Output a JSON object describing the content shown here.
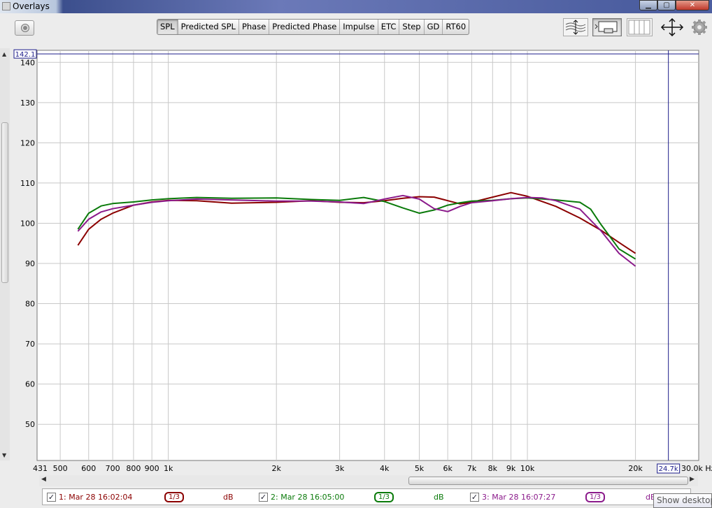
{
  "window": {
    "title": "Overlays"
  },
  "tabs": [
    "SPL",
    "Predicted SPL",
    "Phase",
    "Predicted Phase",
    "Impulse",
    "ETC",
    "Step",
    "GD",
    "RT60"
  ],
  "active_tab": "SPL",
  "cursor": {
    "y_readout": "142.1",
    "x_readout": "24.7k"
  },
  "tooltip": "Show desktop",
  "legend": [
    {
      "check": "✓",
      "name": "1: Mar 28 16:02:04",
      "smoothing": "1/3",
      "unit": "dB",
      "color": "#8b0000"
    },
    {
      "check": "✓",
      "name": "2: Mar 28 16:05:00",
      "smoothing": "1/3",
      "unit": "dB",
      "color": "#0a7a0a"
    },
    {
      "check": "✓",
      "name": "3: Mar 28 16:07:27",
      "smoothing": "1/3",
      "unit": "dB",
      "color": "#8b1a8b"
    }
  ],
  "chart_data": {
    "type": "line",
    "x_scale": "log",
    "xlim": [
      431,
      30000
    ],
    "ylim": [
      41,
      143
    ],
    "ylabel": "dB",
    "xunit": "Hz",
    "grid": true,
    "y_ticks": [
      140,
      130,
      120,
      110,
      100,
      90,
      80,
      70,
      60,
      50
    ],
    "x_tick_values": [
      431,
      500,
      600,
      700,
      800,
      900,
      1000,
      2000,
      3000,
      4000,
      5000,
      6000,
      7000,
      8000,
      9000,
      10000,
      20000,
      30000
    ],
    "x_tick_labels": [
      "431",
      "500",
      "600",
      "700",
      "800",
      "900",
      "1k",
      "2k",
      "3k",
      "4k",
      "5k",
      "6k",
      "7k",
      "8k",
      "9k",
      "10k",
      "20k",
      "30.0k Hz"
    ],
    "cursor": {
      "x": 24700,
      "y": 142.1
    },
    "series": [
      {
        "color": "#8b0000",
        "x": [
          560,
          600,
          650,
          700,
          800,
          900,
          1000,
          1200,
          1500,
          2000,
          2500,
          3000,
          3500,
          4000,
          4500,
          5000,
          5500,
          6000,
          6500,
          7000,
          8000,
          9000,
          10000,
          12000,
          14000,
          16000,
          18000,
          20000
        ],
        "y": [
          94.5,
          98.5,
          101,
          102.5,
          104.5,
          105.3,
          105.7,
          105.6,
          105,
          105.2,
          105.6,
          105.2,
          105.1,
          105.6,
          106.2,
          106.6,
          106.5,
          105.6,
          104.8,
          105.2,
          106.5,
          107.6,
          106.7,
          104.2,
          101.3,
          98.3,
          95.2,
          92.5
        ]
      },
      {
        "color": "#0a7a0a",
        "x": [
          560,
          600,
          650,
          700,
          800,
          900,
          1000,
          1200,
          1500,
          2000,
          2500,
          3000,
          3500,
          4000,
          4500,
          5000,
          5500,
          6000,
          6500,
          7000,
          8000,
          9000,
          10000,
          12000,
          14000,
          15000,
          16000,
          18000,
          20000
        ],
        "y": [
          98.5,
          102.5,
          104.3,
          104.9,
          105.3,
          105.8,
          106.1,
          106.4,
          106.2,
          106.3,
          105.9,
          105.7,
          106.4,
          105.4,
          103.8,
          102.5,
          103.3,
          104.5,
          105.1,
          105.5,
          105.7,
          106.1,
          106.3,
          105.8,
          105.2,
          103.5,
          99.8,
          93.6,
          91.1
        ]
      },
      {
        "color": "#8b1a8b",
        "x": [
          560,
          600,
          650,
          700,
          800,
          900,
          1000,
          1200,
          1500,
          2000,
          2500,
          3000,
          3500,
          4000,
          4500,
          5000,
          5500,
          6000,
          6500,
          7000,
          8000,
          9000,
          10000,
          11000,
          12000,
          14000,
          16000,
          18000,
          20000
        ],
        "y": [
          98,
          101,
          102.8,
          103.6,
          104.5,
          105.2,
          105.6,
          106,
          105.8,
          105.5,
          105.5,
          105.3,
          104.9,
          106,
          106.9,
          106,
          103.6,
          102.9,
          104.2,
          105.1,
          105.6,
          106.1,
          106.4,
          106.3,
          105.6,
          103.5,
          98.2,
          92.5,
          89.3
        ]
      }
    ]
  }
}
